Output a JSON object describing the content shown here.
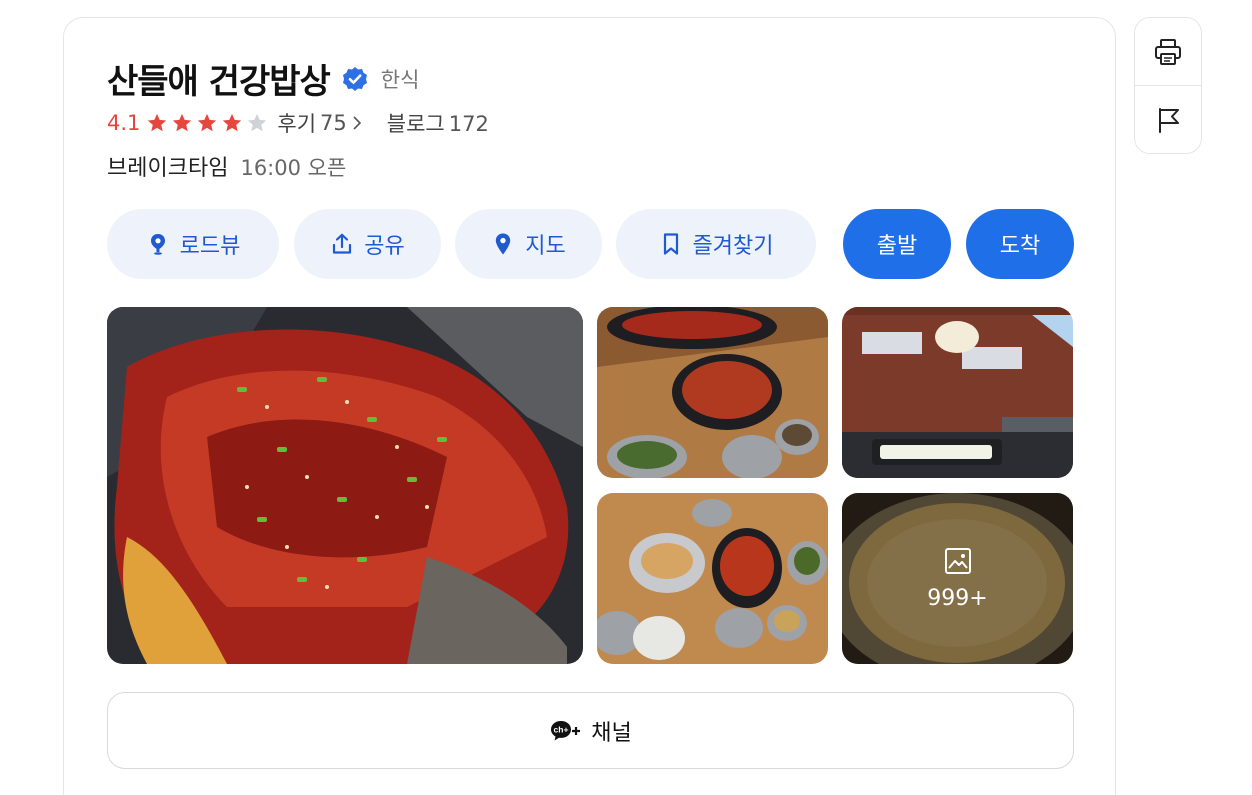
{
  "place": {
    "name": "산들애 건강밥상",
    "category": "한식",
    "rating": "4.1",
    "stars_filled": 4,
    "stars_total": 5,
    "reviews_label": "후기",
    "reviews_count": "75",
    "blog_label": "블로그",
    "blog_count": "172",
    "hours_label": "브레이크타임",
    "hours_value": "16:00 오픈"
  },
  "actions": {
    "roadview": "로드뷰",
    "share": "공유",
    "map": "지도",
    "favorite": "즐겨찾기",
    "depart": "출발",
    "arrive": "도착"
  },
  "photos": {
    "more_count": "999+"
  },
  "channel": {
    "label": "채널",
    "icon_text": "ch+"
  },
  "icons": {
    "verified": "verified-badge-icon",
    "star": "star-icon",
    "print": "print-icon",
    "report": "flag-icon",
    "gallery": "image-icon"
  },
  "colors": {
    "accent": "#1f6fe8",
    "rating": "#e5463d",
    "star_filled": "#e5463d",
    "star_empty": "#cfd2d6",
    "button_bg": "#eef2fb"
  }
}
